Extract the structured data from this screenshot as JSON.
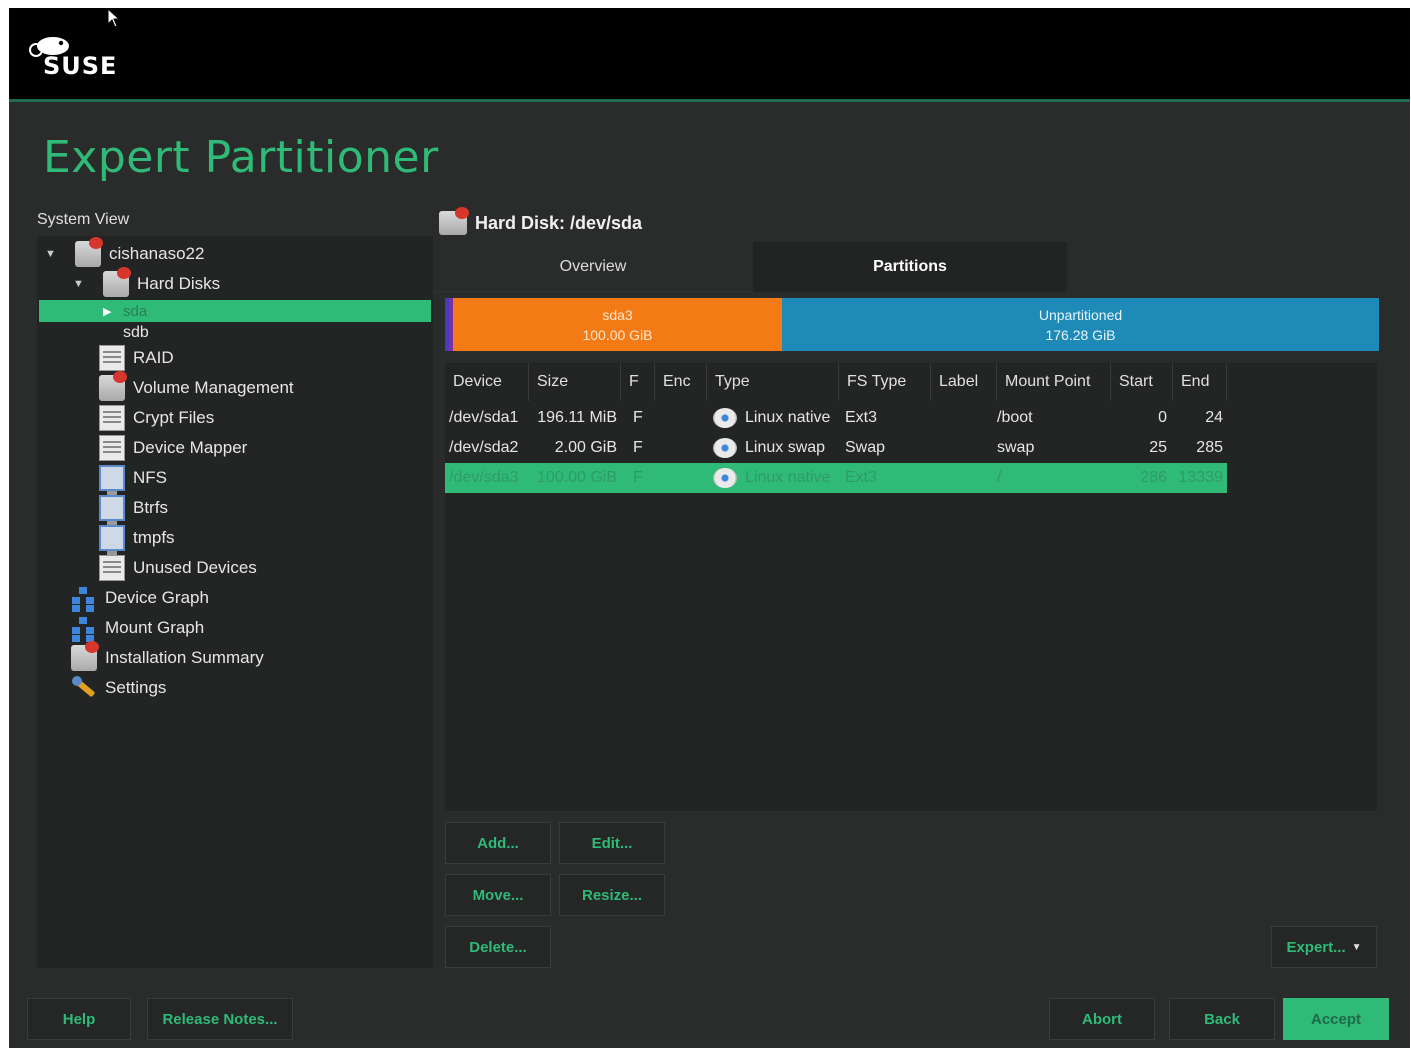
{
  "app": {
    "logo_text": "SUSE",
    "title": "Expert Partitioner"
  },
  "system_view": {
    "label": "System View",
    "items": [
      {
        "label": "cishanaso22",
        "icon": "hard-disk-icon",
        "expanded": true
      },
      {
        "label": "Hard Disks",
        "icon": "hard-disk-icon",
        "expanded": true
      },
      {
        "label": "sda",
        "icon": "",
        "selected": true
      },
      {
        "label": "sdb",
        "icon": ""
      },
      {
        "label": "RAID",
        "icon": "raid-icon"
      },
      {
        "label": "Volume Management",
        "icon": "volume-management-icon"
      },
      {
        "label": "Crypt Files",
        "icon": "crypt-files-icon"
      },
      {
        "label": "Device Mapper",
        "icon": "device-mapper-icon"
      },
      {
        "label": "NFS",
        "icon": "nfs-icon"
      },
      {
        "label": "Btrfs",
        "icon": "btrfs-icon"
      },
      {
        "label": "tmpfs",
        "icon": "tmpfs-icon"
      },
      {
        "label": "Unused Devices",
        "icon": "unused-devices-icon"
      },
      {
        "label": "Device Graph",
        "icon": "device-graph-icon"
      },
      {
        "label": "Mount Graph",
        "icon": "mount-graph-icon"
      },
      {
        "label": "Installation Summary",
        "icon": "installation-summary-icon"
      },
      {
        "label": "Settings",
        "icon": "settings-icon"
      }
    ]
  },
  "detail": {
    "heading": "Hard Disk: /dev/sda",
    "tabs": [
      {
        "label": "Overview"
      },
      {
        "label": "Partitions",
        "active": true
      }
    ],
    "bar": [
      {
        "name": "sda3",
        "size": "100.00 GiB",
        "color": "#f47a15"
      },
      {
        "name": "Unpartitioned",
        "size": "176.28 GiB",
        "color": "#1e8ab8"
      }
    ],
    "columns": [
      "Device",
      "Size",
      "F",
      "Enc",
      "Type",
      "FS Type",
      "Label",
      "Mount Point",
      "Start",
      "End"
    ],
    "rows": [
      {
        "device": "/dev/sda1",
        "size": "196.11 MiB",
        "f": "F",
        "enc": "",
        "type": "Linux native",
        "fs": "Ext3",
        "label": "",
        "mount": "/boot",
        "start": "0",
        "end": "24"
      },
      {
        "device": "/dev/sda2",
        "size": "2.00 GiB",
        "f": "F",
        "enc": "",
        "type": "Linux swap",
        "fs": "Swap",
        "label": "",
        "mount": "swap",
        "start": "25",
        "end": "285"
      },
      {
        "device": "/dev/sda3",
        "size": "100.00 GiB",
        "f": "F",
        "enc": "",
        "type": "Linux native",
        "fs": "Ext3",
        "label": "",
        "mount": "/",
        "start": "286",
        "end": "13339",
        "selected": true
      }
    ]
  },
  "buttons": {
    "add": "Add...",
    "edit": "Edit...",
    "move": "Move...",
    "resize": "Resize...",
    "delete": "Delete...",
    "expert": "Expert...",
    "help": "Help",
    "release_notes": "Release Notes...",
    "abort": "Abort",
    "back": "Back",
    "accept": "Accept"
  },
  "colors": {
    "accent": "#30ba78",
    "background": "#2a2b2b",
    "selection": "#30ba78"
  }
}
